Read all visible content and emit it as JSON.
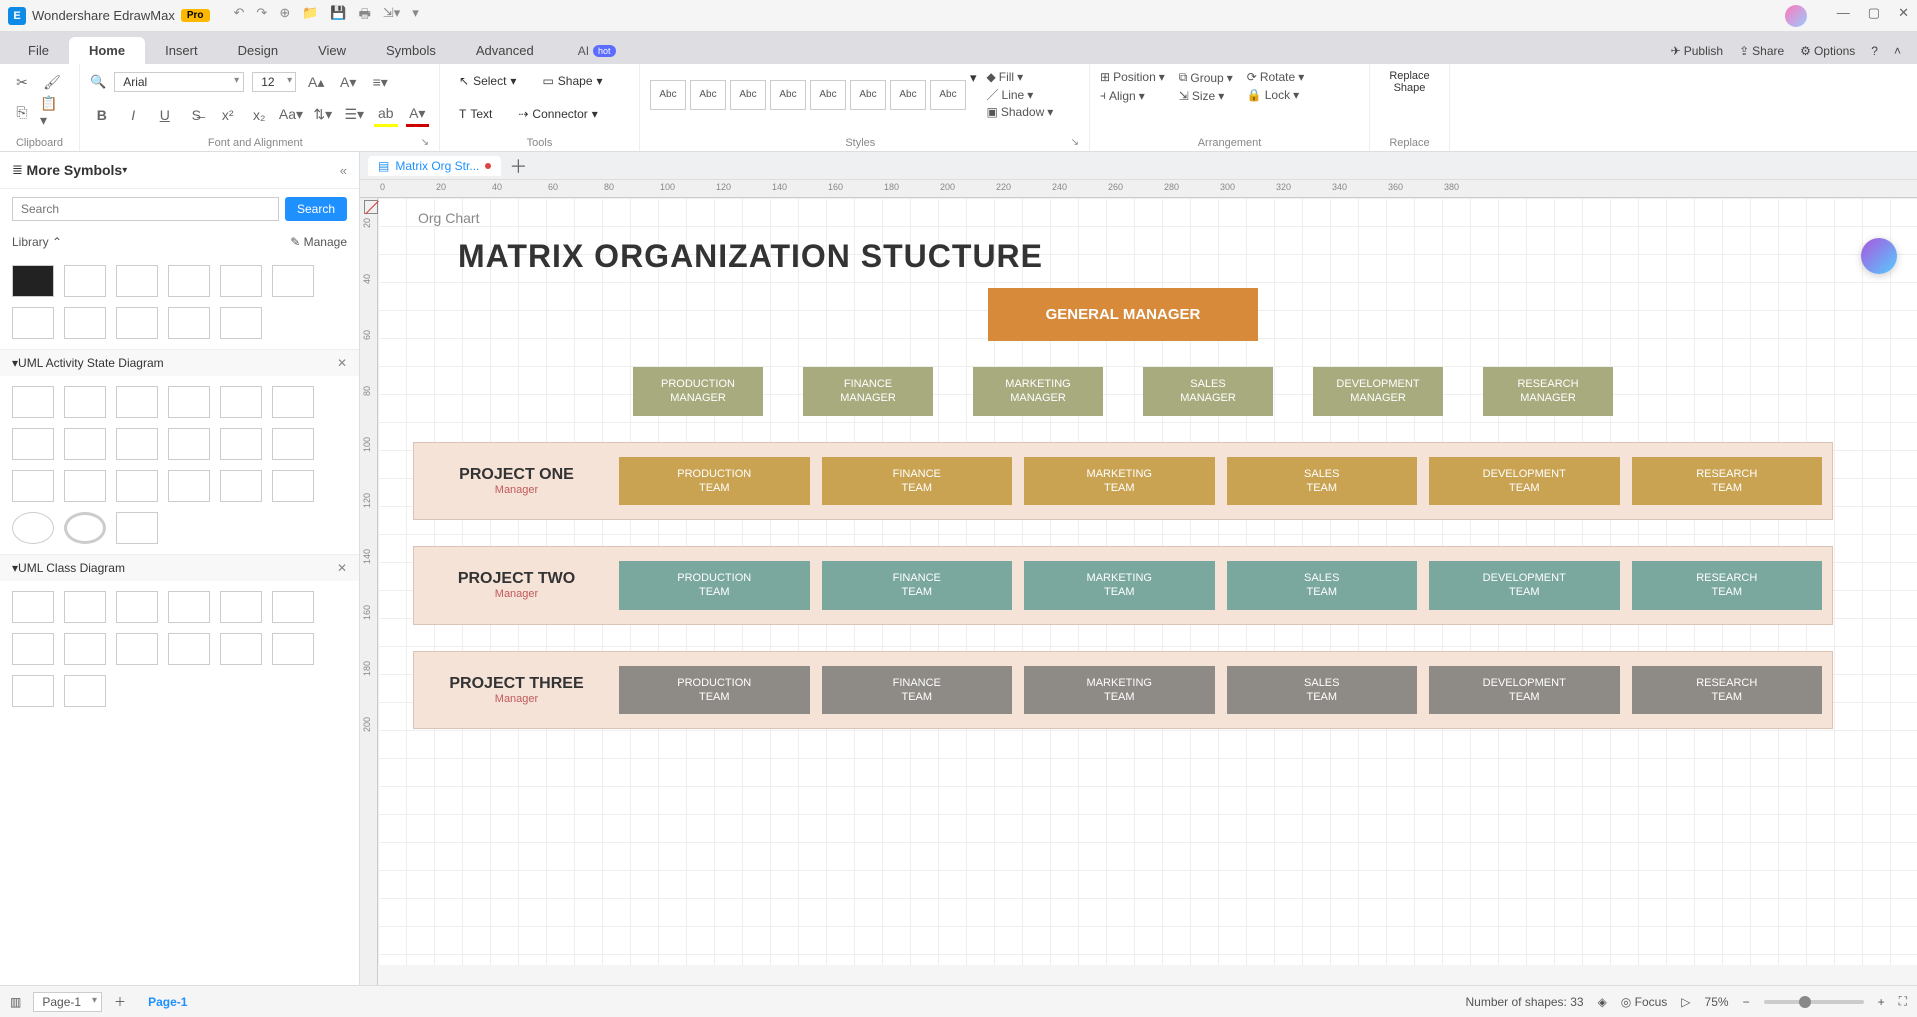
{
  "app": {
    "name": "Wondershare EdrawMax",
    "pro_badge": "Pro"
  },
  "menus": [
    "File",
    "Home",
    "Insert",
    "Design",
    "View",
    "Symbols",
    "Advanced"
  ],
  "active_menu": "Home",
  "ai_label": "AI",
  "ai_badge": "hot",
  "top_right": {
    "publish": "Publish",
    "share": "Share",
    "options": "Options"
  },
  "ribbon": {
    "font_family": "Arial",
    "font_size": "12",
    "select": "Select",
    "shape": "Shape",
    "text": "Text",
    "connector": "Connector",
    "fill": "Fill",
    "line": "Line",
    "shadow": "Shadow",
    "position": "Position",
    "align": "Align",
    "group": "Group",
    "size": "Size",
    "rotate": "Rotate",
    "lock": "Lock",
    "replace_shape": "Replace\nShape",
    "groups": {
      "clipboard": "Clipboard",
      "font": "Font and Alignment",
      "tools": "Tools",
      "styles": "Styles",
      "arrangement": "Arrangement",
      "replace": "Replace"
    },
    "style_swatch": "Abc"
  },
  "left": {
    "title": "More Symbols",
    "search_placeholder": "Search",
    "search_btn": "Search",
    "library": "Library",
    "manage": "Manage",
    "sections": [
      "UML Activity State Diagram",
      "UML Class Diagram"
    ]
  },
  "doc_tab": "Matrix Org Str...",
  "ruler_h": [
    "0",
    "20",
    "40",
    "60",
    "80",
    "100",
    "120",
    "140",
    "160",
    "180",
    "200",
    "220",
    "240",
    "260",
    "280",
    "300",
    "320",
    "340",
    "360",
    "380"
  ],
  "ruler_v": [
    "20",
    "40",
    "60",
    "80",
    "100",
    "120",
    "140",
    "160",
    "180",
    "200"
  ],
  "canvas": {
    "category_label": "Org Chart",
    "title": "MATRIX ORGANIZATION STUCTURE",
    "general_manager": "GENERAL MANAGER",
    "managers": [
      "PRODUCTION\nMANAGER",
      "FINANCE\nMANAGER",
      "MARKETING\nMANAGER",
      "SALES\nMANAGER",
      "DEVELOPMENT\nMANAGER",
      "RESEARCH\nMANAGER"
    ],
    "projects": [
      {
        "name": "PROJECT ONE",
        "mgr": "Manager",
        "color": "#c9a352"
      },
      {
        "name": "PROJECT TWO",
        "mgr": "Manager",
        "color": "#7aa79e"
      },
      {
        "name": "PROJECT THREE",
        "mgr": "Manager",
        "color": "#8e8a85"
      }
    ],
    "teams": [
      "PRODUCTION\nTEAM",
      "FINANCE\nTEAM",
      "MARKETING\nTEAM",
      "SALES\nTEAM",
      "DEVELOPMENT\nTEAM",
      "RESEARCH\nTEAM"
    ]
  },
  "status": {
    "page_select": "Page-1",
    "page_tab": "Page-1",
    "shapes": "Number of shapes: 33",
    "focus": "Focus",
    "zoom": "75%"
  },
  "colors": [
    "#000",
    "#c0392b",
    "#e74c3c",
    "#ec7063",
    "#af7ac5",
    "#5dade2",
    "#48c9b0",
    "#45b39d",
    "#52be80",
    "#58d68d",
    "#f4d03f",
    "#f5b041",
    "#eb984e",
    "#dc7633",
    "#e67e22",
    "#d35400",
    "#ba4a00",
    "#a04000",
    "#6e2c00",
    "#17202a",
    "#f39c12",
    "#f1c40f",
    "#2ecc71",
    "#27ae60",
    "#16a085",
    "#1abc9c",
    "#3498db",
    "#2980b9",
    "#8e44ad",
    "#9b59b6",
    "#e91e63",
    "#f06292",
    "#f48fb1",
    "#ce93d8",
    "#ba68c8",
    "#ab47bc",
    "#7e57c2",
    "#5c6bc0",
    "#42a5f5",
    "#29b6f6",
    "#26c6da",
    "#26a69a",
    "#66bb6a",
    "#9ccc65",
    "#d4e157",
    "#ffee58",
    "#ffca28",
    "#ffa726",
    "#ff7043",
    "#8d6e63",
    "#bdbdbd",
    "#78909c",
    "#ef5350",
    "#ec407a",
    "#7cb342",
    "#c0ca33",
    "#fdd835",
    "#ffb300",
    "#fb8c00",
    "#f4511e",
    "#6d4c41",
    "#757575",
    "#546e7a",
    "#d32f2f",
    "#c2185b",
    "#7b1fa2",
    "#512da8",
    "#303f9f",
    "#1976d2",
    "#0288d1",
    "#0097a7",
    "#00796b",
    "#388e3c",
    "#689f38",
    "#afb42b",
    "#fbc02d",
    "#ffa000",
    "#f57c00",
    "#e64a19",
    "#5d4037",
    "#616161",
    "#455a64",
    "#b71c1c",
    "#880e4f",
    "#4a148c",
    "#311b92",
    "#1a237e",
    "#0d47a1",
    "#01579b",
    "#006064",
    "#004d40",
    "#1b5e20",
    "#33691e",
    "#827717",
    "#f57f17",
    "#ff6f00",
    "#e65100",
    "#bf360c",
    "#3e2723",
    "#212121",
    "#000",
    "#333",
    "#666",
    "#999",
    "#ccc",
    "#fff"
  ],
  "chart_data": {
    "type": "org-matrix",
    "title": "MATRIX ORGANIZATION STUCTURE",
    "root": "GENERAL MANAGER",
    "functional_managers": [
      "PRODUCTION MANAGER",
      "FINANCE MANAGER",
      "MARKETING MANAGER",
      "SALES MANAGER",
      "DEVELOPMENT MANAGER",
      "RESEARCH MANAGER"
    ],
    "projects": [
      {
        "name": "PROJECT ONE",
        "manager": "Manager",
        "teams": [
          "PRODUCTION TEAM",
          "FINANCE TEAM",
          "MARKETING TEAM",
          "SALES TEAM",
          "DEVELOPMENT TEAM",
          "RESEARCH TEAM"
        ]
      },
      {
        "name": "PROJECT TWO",
        "manager": "Manager",
        "teams": [
          "PRODUCTION TEAM",
          "FINANCE TEAM",
          "MARKETING TEAM",
          "SALES TEAM",
          "DEVELOPMENT TEAM",
          "RESEARCH TEAM"
        ]
      },
      {
        "name": "PROJECT THREE",
        "manager": "Manager",
        "teams": [
          "PRODUCTION TEAM",
          "FINANCE TEAM",
          "MARKETING TEAM",
          "SALES TEAM",
          "DEVELOPMENT TEAM",
          "RESEARCH TEAM"
        ]
      }
    ]
  }
}
